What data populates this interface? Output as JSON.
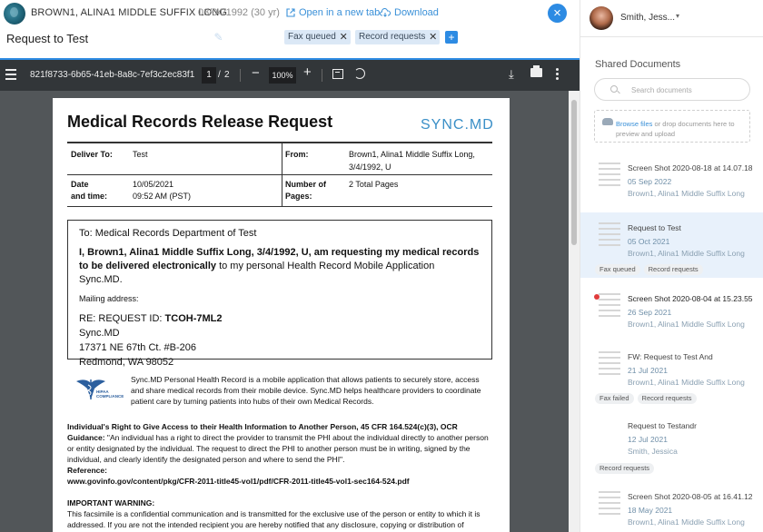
{
  "patient": {
    "name": "BROWN1, ALINA1 MIDDLE SUFFIX LONG",
    "dob": "03/04/1992 (30 yr)"
  },
  "actions": {
    "open_new_tab": "Open in a new tab",
    "download": "Download",
    "close": "×"
  },
  "document": {
    "title": "Request to Test",
    "tags": [
      "Fax queued",
      "Record requests"
    ],
    "add_tag": "+"
  },
  "pdf_toolbar": {
    "filename": "821f8733-6b65-41eb-8a8c-7ef3c2ec83f1",
    "page_current": "1",
    "page_sep": "/",
    "page_total": "2",
    "zoom_out": "−",
    "zoom": "100%",
    "zoom_in": "+"
  },
  "pdf_page": {
    "heading": "Medical Records Release Request",
    "logo": "SYNC.MD",
    "deliver_to_label": "Deliver To:",
    "deliver_to": "Test",
    "from_label": "From:",
    "from_line1": "Brown1, Alina1 Middle Suffix Long,",
    "from_line2": "3/4/1992, U",
    "date_label1": "Date",
    "date_label2": "and time:",
    "date": "10/05/2021",
    "time": "09:52 AM (PST)",
    "pages_label1": "Number of",
    "pages_label2": "Pages:",
    "pages": "2 Total Pages",
    "to_line": "To: Medical Records Department of Test",
    "statement_bold": "I, Brown1, Alina1 Middle Suffix Long, 3/4/1992, U, am requesting my medical records to be delivered electronically",
    "statement_rest": " to my personal Health Record Mobile Application Sync.MD.",
    "mailing_label": "Mailing address:",
    "re_prefix": "RE: REQUEST ID: ",
    "request_id": "TCOH-7ML2",
    "addr1": "Sync.MD",
    "addr2": "17371 NE 67th Ct. #B-206",
    "addr3": "Redmond, WA 98052",
    "hipaa_logo_text": "HIPAA COMPLIANCE",
    "hipaa_text": "Sync.MD Personal Health Record is a mobile application that allows patients to securely store, access and share medical records from their mobile device. Sync.MD helps healthcare providers to coordinate patient care by turning patients into hubs of their own Medical Records.",
    "rights_bold": "Individual's Right to Give Access to their Health Information to Another Person, 45 CFR 164.524(c)(3), OCR Guidance:",
    "rights_text": " \"An individual has a right to direct the provider to transmit the PHI about the individual directly to another person or entity designated by the individual. The request to direct the PHI to another person must be in writing, signed by the individual, and clearly identify the designated person and where to send the PHI\".",
    "reference_label": "Reference:",
    "reference_url": "www.govinfo.gov/content/pkg/CFR-2011-title45-vol1/pdf/CFR-2011-title45-vol1-sec164-524.pdf",
    "warning_title": "IMPORTANT WARNING:",
    "warning_text": "This facsimile is a confidential communication and is transmitted for the exclusive use of the person or entity to which it is addressed. If you are not the intended recipient you are hereby notified that any disclosure, copying or distribution of"
  },
  "user": {
    "name": "Smith, Jess...",
    "caret": "▾"
  },
  "shared": {
    "title": "Shared Documents",
    "search_placeholder": "Search documents",
    "upload_browse": "Browse files",
    "upload_rest": " or drop documents here to preview and upload"
  },
  "documents": [
    {
      "name": "Screen Shot 2020-08-18 at 14.07.18",
      "date": "05 Sep 2022",
      "patient": "Brown1, Alina1 Middle Suffix Long",
      "tags": []
    },
    {
      "name": "Request to Test",
      "date": "05 Oct 2021",
      "patient": "Brown1, Alina1 Middle Suffix Long",
      "tags": [
        "Fax queued",
        "Record requests"
      ]
    },
    {
      "name": "Screen Shot 2020-08-04 at 15.23.55",
      "date": "26 Sep 2021",
      "patient": "Brown1, Alina1 Middle Suffix Long",
      "tags": []
    },
    {
      "name": "FW: Request to Test And",
      "date": "21 Jul 2021",
      "patient": "Brown1, Alina1 Middle Suffix Long",
      "tags": [
        "Fax failed",
        "Record requests"
      ]
    },
    {
      "name": "Request to Testandr",
      "date": "12 Jul 2021",
      "patient": "Smith, Jessica",
      "tags": [
        "Record requests"
      ]
    },
    {
      "name": "Screen Shot 2020-08-05 at 16.41.12",
      "date": "18 May 2021",
      "patient": "Brown1, Alina1 Middle Suffix Long",
      "tags": []
    }
  ]
}
